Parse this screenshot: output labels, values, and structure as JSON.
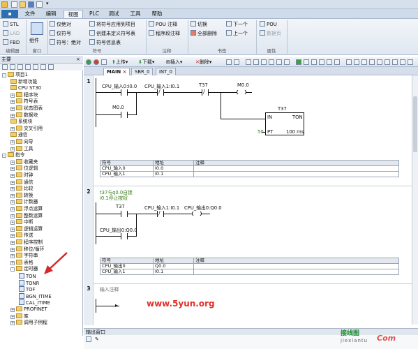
{
  "menu": [
    "文件",
    "编辑",
    "视图",
    "PLC",
    "调试",
    "工具",
    "帮助"
  ],
  "menu_active": "视图",
  "ribbon": {
    "editor_col": [
      "STL",
      "LAD",
      "FBD"
    ],
    "editor_group": "编辑器",
    "component": "组件",
    "window_group": "窗口",
    "symbol_btns": [
      "仅绝对",
      "仅符号",
      "符号：绝对"
    ],
    "symbol_btns2": [
      "将符号应用到项目",
      "创建未定义符号表",
      "符号信息表"
    ],
    "symbol_group": "符号",
    "comment_btns": [
      "POU 注释",
      "程序段注释"
    ],
    "comment_group": "注释",
    "bookmark_btns": [
      "切换",
      "全部删除",
      "下一个",
      "上一个"
    ],
    "bookmark_group": "书签",
    "prop_btns": [
      "POU",
      "数据页"
    ],
    "prop_group": "属性"
  },
  "left_panel": {
    "title": "主要"
  },
  "tree": [
    {
      "label": "项目1",
      "lvl": 0,
      "ex": "-"
    },
    {
      "label": "新增功能",
      "lvl": 1
    },
    {
      "label": "CPU ST30",
      "lvl": 1
    },
    {
      "label": "程序块",
      "lvl": 1,
      "ex": "+",
      "fold": true
    },
    {
      "label": "符号表",
      "lvl": 1,
      "ex": "+",
      "fold": true
    },
    {
      "label": "状态图表",
      "lvl": 1,
      "ex": "+",
      "fold": true
    },
    {
      "label": "数据块",
      "lvl": 1,
      "ex": "+",
      "fold": true
    },
    {
      "label": "系统块",
      "lvl": 1
    },
    {
      "label": "交叉引用",
      "lvl": 1,
      "ex": "+",
      "fold": true
    },
    {
      "label": "通信",
      "lvl": 1
    },
    {
      "label": "向导",
      "lvl": 1,
      "ex": "+",
      "fold": true
    },
    {
      "label": "工具",
      "lvl": 1,
      "ex": "+",
      "fold": true
    },
    {
      "label": "指令",
      "lvl": 0,
      "ex": "-"
    },
    {
      "label": "收藏夹",
      "lvl": 1,
      "ex": "+",
      "fold": true
    },
    {
      "label": "位逻辑",
      "lvl": 1,
      "ex": "+",
      "fold": true
    },
    {
      "label": "时钟",
      "lvl": 1,
      "ex": "+",
      "fold": true
    },
    {
      "label": "通信",
      "lvl": 1,
      "ex": "+",
      "fold": true
    },
    {
      "label": "比较",
      "lvl": 1,
      "ex": "+",
      "fold": true
    },
    {
      "label": "转换",
      "lvl": 1,
      "ex": "+",
      "fold": true
    },
    {
      "label": "计数器",
      "lvl": 1,
      "ex": "+",
      "fold": true
    },
    {
      "label": "浮点运算",
      "lvl": 1,
      "ex": "+",
      "fold": true
    },
    {
      "label": "整数运算",
      "lvl": 1,
      "ex": "+",
      "fold": true
    },
    {
      "label": "中断",
      "lvl": 1,
      "ex": "+",
      "fold": true
    },
    {
      "label": "逻辑运算",
      "lvl": 1,
      "ex": "+",
      "fold": true
    },
    {
      "label": "传送",
      "lvl": 1,
      "ex": "+",
      "fold": true
    },
    {
      "label": "程序控制",
      "lvl": 1,
      "ex": "+",
      "fold": true
    },
    {
      "label": "移位/循环",
      "lvl": 1,
      "ex": "+",
      "fold": true
    },
    {
      "label": "字符串",
      "lvl": 1,
      "ex": "+",
      "fold": true
    },
    {
      "label": "表格",
      "lvl": 1,
      "ex": "+",
      "fold": true
    },
    {
      "label": "定时器",
      "lvl": 1,
      "ex": "-",
      "fold": true
    },
    {
      "label": "TON",
      "lvl": 2,
      "box": true
    },
    {
      "label": "TONR",
      "lvl": 2,
      "box": true
    },
    {
      "label": "TOF",
      "lvl": 2,
      "box": true
    },
    {
      "label": "BGN_ITIME",
      "lvl": 2,
      "box": true
    },
    {
      "label": "CAL_ITIME",
      "lvl": 2,
      "box": true
    },
    {
      "label": "PROFINET",
      "lvl": 1,
      "ex": "+",
      "fold": true
    },
    {
      "label": "库",
      "lvl": 1,
      "ex": "+",
      "fold": true
    },
    {
      "label": "调用子例程",
      "lvl": 1,
      "ex": "+",
      "fold": true
    }
  ],
  "editor_toolbar": {
    "upload": "上传",
    "download": "下载",
    "insert": "插入",
    "delete": "删除"
  },
  "tabs": [
    "MAIN",
    "SBR_0",
    "INT_0"
  ],
  "seg1": {
    "num": "1",
    "c1": "CPU_输入0:I0.0",
    "c2": "CPU_输入1:I0.1",
    "c3": "T37",
    "coil": "M0.0",
    "c4": "M0.0",
    "timer": "T37",
    "timer_in": "IN",
    "timer_type": "TON",
    "timer_pt": "PT",
    "timer_pt_val": "50",
    "timer_base": "100 ms",
    "table_hdr": [
      "符号",
      "地址",
      "注释"
    ],
    "table": [
      [
        "CPU_输入0",
        "I0.0",
        ""
      ],
      [
        "CPU_输入1",
        "I0.1",
        ""
      ]
    ]
  },
  "seg2": {
    "num": "2",
    "comment1": "t37与q0.0自锁",
    "comment2": "i0.1停止按钮",
    "c1": "T37",
    "c2": "CPU_输入1:I0.1",
    "coil": "CPU_输出0:Q0.0",
    "c3": "CPU_输出0:Q0.0",
    "table_hdr": [
      "符号",
      "地址",
      "注释"
    ],
    "table": [
      [
        "CPU_输出0",
        "Q0.0",
        ""
      ],
      [
        "CPU_输入1",
        "I0.1",
        ""
      ]
    ]
  },
  "seg3": {
    "num": "3",
    "comment": "输入注释"
  },
  "output_window": "输出窗口",
  "watermark": "www.5yun.org",
  "wm_cn": "接线图",
  "wm_en": "jiexiantu",
  "wm_logo": "Com"
}
